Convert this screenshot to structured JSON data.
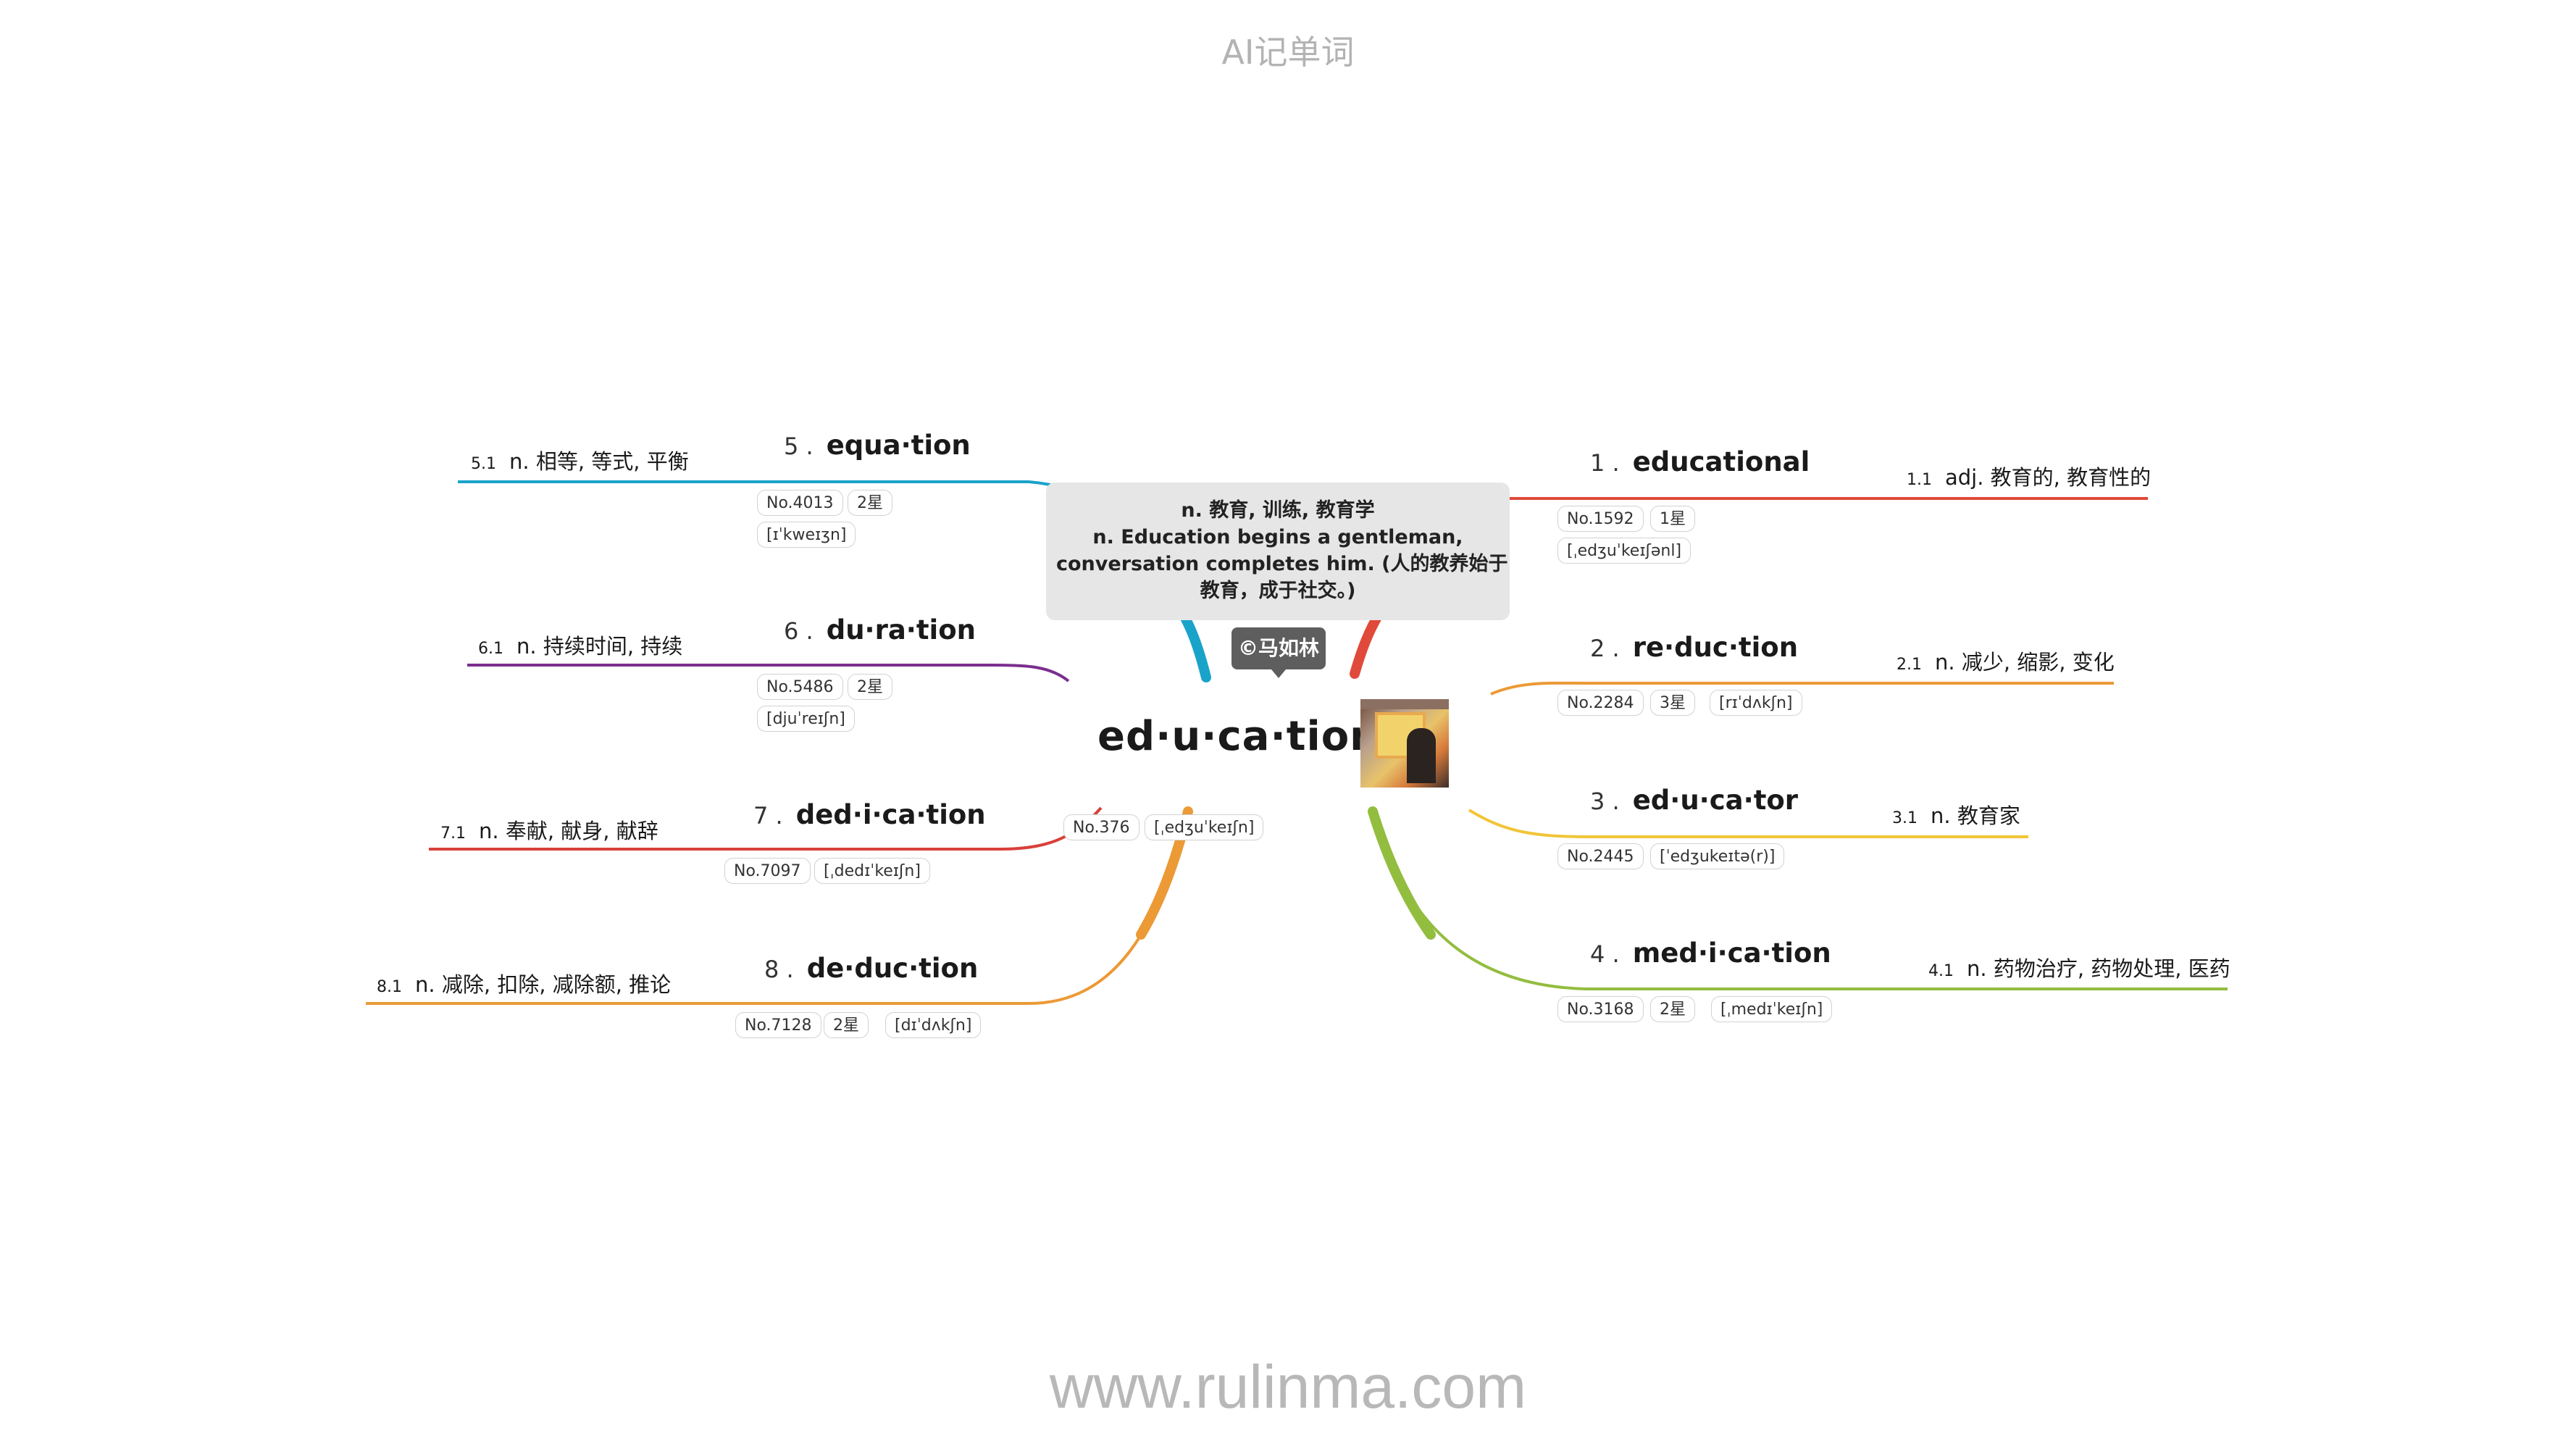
{
  "header": {
    "title": "AI记单词"
  },
  "footer": {
    "url": "www.rulinma.com"
  },
  "root": {
    "word": "ed·u·ca·tion",
    "definition_lines": [
      "n. 教育, 训练, 教育学",
      "n. Education begins a gentleman,",
      "conversation completes him. (人的教养始于",
      "教育，成于社交。)"
    ],
    "author": "©马如林",
    "number": "No.376",
    "phonetic": "[ˌedʒuˈkeɪʃn]"
  },
  "branches": [
    {
      "index": "1 .",
      "word": "educational",
      "number": "No.1592",
      "stars": "1星",
      "phonetic": "[ˌedʒuˈkeɪʃənl]",
      "meaning_index": "1.1",
      "meaning": "adj. 教育的, 教育性的",
      "color": "#e04a3a"
    },
    {
      "index": "2 .",
      "word": "re·duc·tion",
      "number": "No.2284",
      "stars": "3星",
      "phonetic": "[rɪˈdʌkʃn]",
      "meaning_index": "2.1",
      "meaning": "n. 减少, 缩影, 变化",
      "color": "#ec9a36"
    },
    {
      "index": "3 .",
      "word": "ed·u·ca·tor",
      "number": "No.2445",
      "phonetic": "[ˈedʒukeɪtə(r)]",
      "meaning_index": "3.1",
      "meaning": "n. 教育家",
      "color": "#f1c539"
    },
    {
      "index": "4 .",
      "word": "med·i·ca·tion",
      "number": "No.3168",
      "stars": "2星",
      "phonetic": "[ˌmedɪˈkeɪʃn]",
      "meaning_index": "4.1",
      "meaning": "n. 药物治疗, 药物处理, 医药",
      "color": "#93bd3f"
    },
    {
      "index": "5 .",
      "word": "equa·tion",
      "number": "No.4013",
      "stars": "2星",
      "phonetic": "[ɪˈkweɪʒn]",
      "meaning_index": "5.1",
      "meaning": "n. 相等, 等式, 平衡",
      "color": "#1aa3c9"
    },
    {
      "index": "6 .",
      "word": "du·ra·tion",
      "number": "No.5486",
      "stars": "2星",
      "phonetic": "[djuˈreɪʃn]",
      "meaning_index": "6.1",
      "meaning": "n. 持续时间, 持续",
      "color": "#7b2e8e"
    },
    {
      "index": "7 .",
      "word": "ded·i·ca·tion",
      "number": "No.7097",
      "phonetic": "[ˌdedɪˈkeɪʃn]",
      "meaning_index": "7.1",
      "meaning": "n. 奉献, 献身, 献辞",
      "color": "#d9403a"
    },
    {
      "index": "8 .",
      "word": "de·duc·tion",
      "number": "No.7128",
      "stars": "2星",
      "phonetic": "[dɪˈdʌkʃn]",
      "meaning_index": "8.1",
      "meaning": "n. 减除, 扣除, 减除额, 推论",
      "color": "#ec9a36"
    }
  ]
}
